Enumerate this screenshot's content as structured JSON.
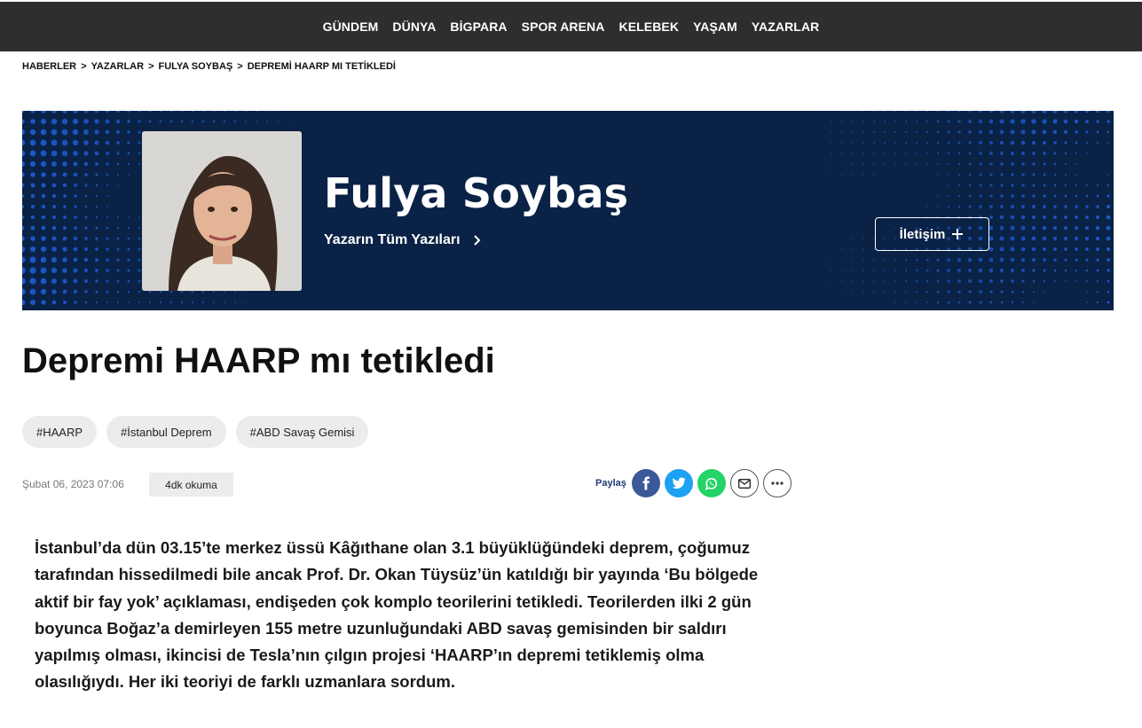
{
  "nav": {
    "items": [
      "GÜNDEM",
      "DÜNYA",
      "BİGPARA",
      "SPOR ARENA",
      "KELEBEK",
      "YAŞAM",
      "YAZARLAR"
    ]
  },
  "breadcrumb": {
    "items": [
      "HABERLER",
      "YAZARLAR",
      "FULYA SOYBAŞ",
      "DEPREMİ HAARP MI TETİKLEDİ"
    ],
    "separator": ">"
  },
  "author": {
    "name": "Fulya Soybaş",
    "all_posts_label": "Yazarın Tüm Yazıları",
    "contact_label": "İletişim"
  },
  "article": {
    "title": "Depremi HAARP mı tetikledi",
    "tags": [
      "#HAARP",
      "#İstanbul Deprem",
      "#ABD Savaş Gemisi"
    ],
    "date": "Şubat 06, 2023 07:06",
    "read_time": "4dk okuma",
    "body": "İstanbul’da dün 03.15’te merkez üssü Kâğıthane olan 3.1 büyüklüğündeki deprem, çoğumuz tarafından hissedilmedi bile ancak Prof. Dr. Okan Tüysüz’ün katıldığı bir yayında ‘Bu bölgede aktif bir fay yok’ açıklaması, endişeden çok komplo teorilerini tetikledi. Teorilerden ilki 2 gün boyunca Boğaz’a demirleyen 155 metre uzunluğundaki ABD savaş gemisinden bir saldırı yapılmış olması, ikincisi de Tesla’nın çılgın projesi ‘HAARP’ın depremi tetiklemiş olma olasılığıydı. Her iki teoriyi de farklı uzmanlara sordum."
  },
  "share": {
    "label": "Paylaş",
    "buttons": [
      "facebook-icon",
      "twitter-icon",
      "whatsapp-icon",
      "mail-icon",
      "more-icon"
    ]
  },
  "colors": {
    "nav_bg": "#2e2e2e",
    "banner_bg": "#0a2246",
    "dots": "#1e5fd6",
    "facebook": "#3b5998",
    "twitter": "#1da1f2",
    "whatsapp": "#25d366",
    "share_label": "#1f3c78"
  }
}
